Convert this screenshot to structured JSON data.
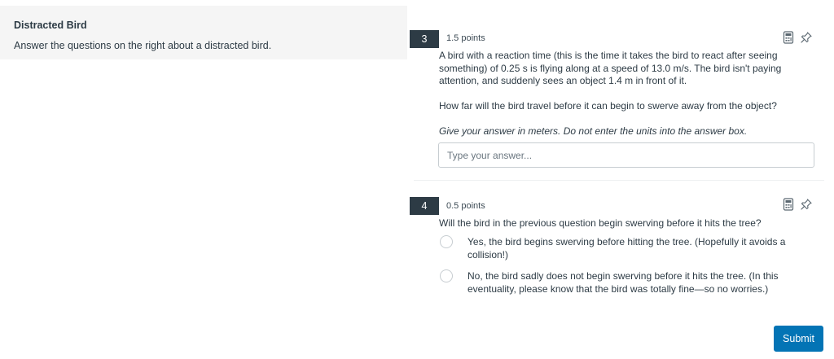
{
  "left_panel": {
    "title": "Distracted Bird",
    "description": "Answer the questions on the right about a distracted bird."
  },
  "questions": [
    {
      "number": "3",
      "points": "1.5 points",
      "paragraph1": "A bird with a reaction time (this is the time it takes the bird to react after seeing something) of 0.25 s is flying along at a speed of 13.0 m/s. The bird isn't paying attention, and suddenly sees an object 1.4 m in front of it.",
      "paragraph2": "How far will the bird travel before it can begin to swerve away from the object?",
      "instruction": "Give your answer in meters. Do not enter the units into the answer box.",
      "input_placeholder": "Type your answer...",
      "input_value": ""
    },
    {
      "number": "4",
      "points": "0.5 points",
      "prompt": "Will the bird in the previous question begin swerving before it hits the tree?",
      "options": [
        {
          "label": "Yes, the bird begins swerving before hitting the tree. (Hopefully it avoids a collision!)",
          "selected": false
        },
        {
          "label": "No, the bird sadly does not begin swerving before it hits the tree. (In this eventuality, please know that the bird was totally fine—so no worries.)",
          "selected": false
        }
      ]
    }
  ],
  "icons": {
    "tool": "calculator-icon",
    "pin": "pin-icon"
  },
  "submit_label": "Submit",
  "colors": {
    "accent": "#0374b5",
    "badge": "#2d3b45",
    "panel": "#f5f5f5"
  }
}
